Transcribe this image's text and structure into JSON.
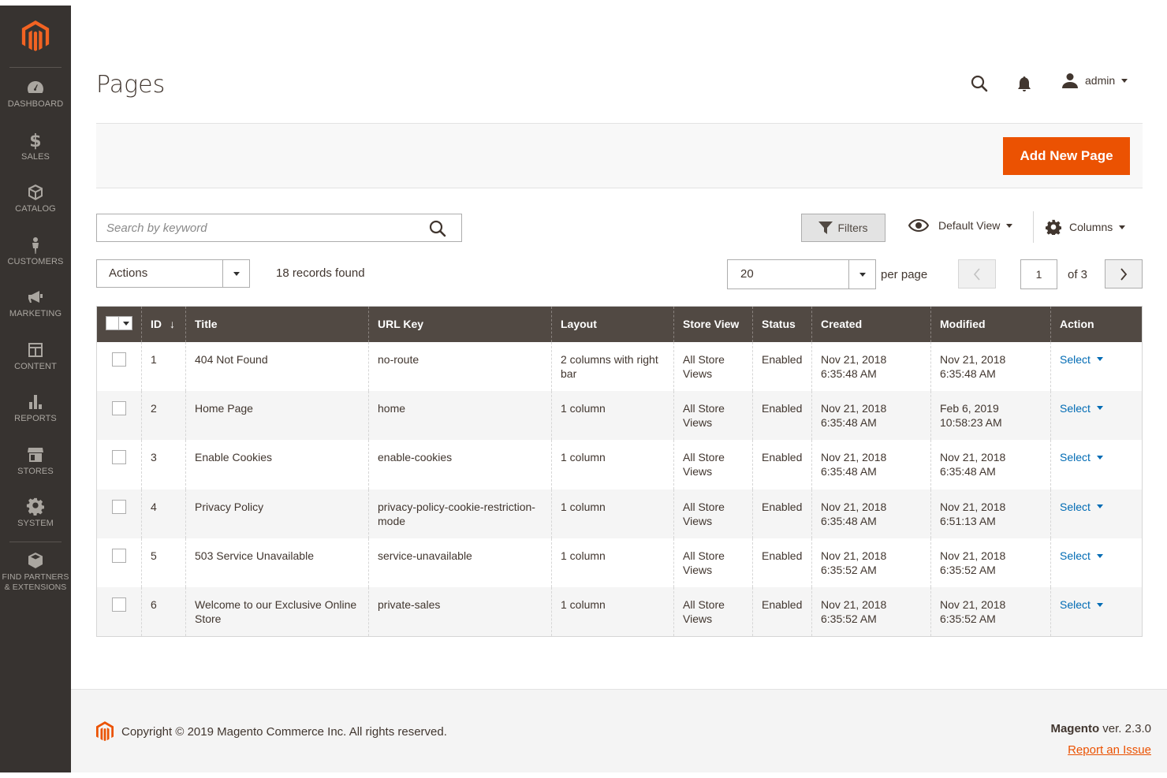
{
  "sidebar": {
    "logo": "magento-logo",
    "items": [
      {
        "label": "DASHBOARD",
        "icon": "dashboard-icon"
      },
      {
        "label": "SALES",
        "icon": "dollar-icon"
      },
      {
        "label": "CATALOG",
        "icon": "cube-icon"
      },
      {
        "label": "CUSTOMERS",
        "icon": "person-icon"
      },
      {
        "label": "MARKETING",
        "icon": "megaphone-icon"
      },
      {
        "label": "CONTENT",
        "icon": "layout-icon"
      },
      {
        "label": "REPORTS",
        "icon": "bar-chart-icon"
      },
      {
        "label": "STORES",
        "icon": "storefront-icon"
      },
      {
        "label": "SYSTEM",
        "icon": "gear-icon"
      }
    ],
    "partners_line1": "FIND PARTNERS",
    "partners_line2": "& EXTENSIONS"
  },
  "header": {
    "title": "Pages",
    "user": "admin"
  },
  "action_bar": {
    "add_label": "Add New Page"
  },
  "toolbar": {
    "search_placeholder": "Search by keyword",
    "filters_label": "Filters",
    "view_label": "Default View",
    "columns_label": "Columns",
    "actions_label": "Actions",
    "records_found": "18 records found",
    "per_page_value": "20",
    "per_page_label": "per page",
    "current_page": "1",
    "page_of": "of 3"
  },
  "grid": {
    "columns": [
      "ID",
      "Title",
      "URL Key",
      "Layout",
      "Store View",
      "Status",
      "Created",
      "Modified",
      "Action"
    ],
    "rows": [
      {
        "id": "1",
        "title": "404 Not Found",
        "url_key": "no-route",
        "layout": "2 columns with right bar",
        "store_view": "All Store Views",
        "status": "Enabled",
        "created": "Nov 21, 2018 6:35:48 AM",
        "modified": "Nov 21, 2018 6:35:48 AM",
        "action": "Select"
      },
      {
        "id": "2",
        "title": "Home Page",
        "url_key": "home",
        "layout": "1 column",
        "store_view": "All Store Views",
        "status": "Enabled",
        "created": "Nov 21, 2018 6:35:48 AM",
        "modified": "Feb 6, 2019 10:58:23 AM",
        "action": "Select"
      },
      {
        "id": "3",
        "title": "Enable Cookies",
        "url_key": "enable-cookies",
        "layout": "1 column",
        "store_view": "All Store Views",
        "status": "Enabled",
        "created": "Nov 21, 2018 6:35:48 AM",
        "modified": "Nov 21, 2018 6:35:48 AM",
        "action": "Select"
      },
      {
        "id": "4",
        "title": "Privacy Policy",
        "url_key": "privacy-policy-cookie-restriction-mode",
        "layout": "1 column",
        "store_view": "All Store Views",
        "status": "Enabled",
        "created": "Nov 21, 2018 6:35:48 AM",
        "modified": "Nov 21, 2018 6:51:13 AM",
        "action": "Select"
      },
      {
        "id": "5",
        "title": "503 Service Unavailable",
        "url_key": "service-unavailable",
        "layout": "1 column",
        "store_view": "All Store Views",
        "status": "Enabled",
        "created": "Nov 21, 2018 6:35:52 AM",
        "modified": "Nov 21, 2018 6:35:52 AM",
        "action": "Select"
      },
      {
        "id": "6",
        "title": "Welcome to our Exclusive Online Store",
        "url_key": "private-sales",
        "layout": "1 column",
        "store_view": "All Store Views",
        "status": "Enabled",
        "created": "Nov 21, 2018 6:35:52 AM",
        "modified": "Nov 21, 2018 6:35:52 AM",
        "action": "Select"
      }
    ]
  },
  "footer": {
    "copyright": "Copyright © 2019 Magento Commerce Inc. All rights reserved.",
    "version_brand": "Magento",
    "version_text": " ver. 2.3.0",
    "report_link": "Report an Issue"
  },
  "colors": {
    "sidebar_bg": "#373330",
    "accent": "#eb5202",
    "table_header": "#514943",
    "link": "#006bb4"
  }
}
